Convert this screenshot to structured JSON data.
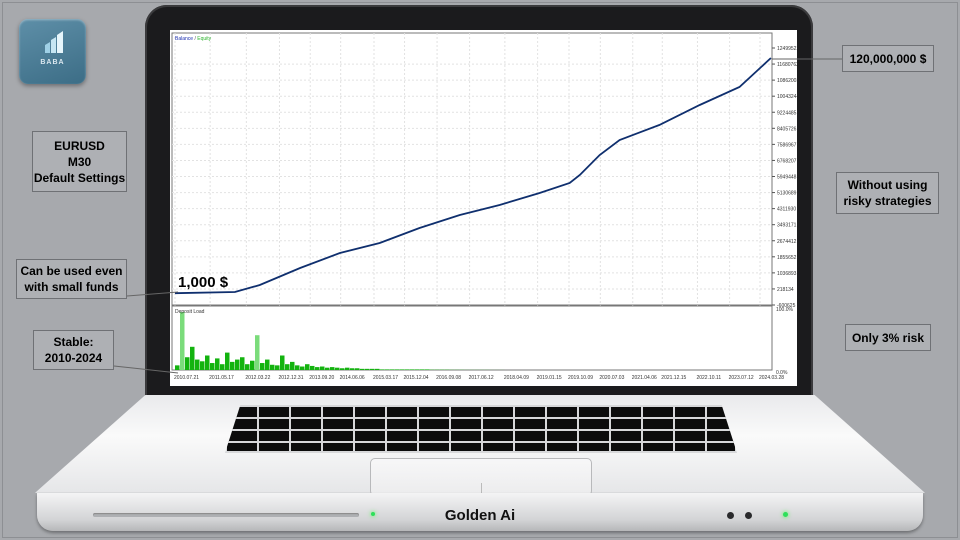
{
  "logo": {
    "text": "BABA"
  },
  "callouts": {
    "pair": [
      "EURUSD",
      "M30",
      "Default Settings"
    ],
    "small_funds": [
      "Can be used even",
      "with small funds"
    ],
    "stable": [
      "Stable:",
      "2010-2024"
    ],
    "final_balance": "120,000,000 $",
    "no_risky": [
      "Without using",
      "risky strategies"
    ],
    "risk": "Only 3% risk"
  },
  "laptop": {
    "brand": "Golden Ai"
  },
  "colors": {
    "balance_line": "#0f2f6e",
    "deposit_load": "#13b30f",
    "deposit_load_light": "#7bdc7b",
    "background": "#a7a9ad"
  },
  "chart_data": [
    {
      "type": "line",
      "legend": {
        "balance": "Balance",
        "sep": " / ",
        "equity": "Equity"
      },
      "legend_placement": "top-left",
      "annotation": "1,000 $",
      "grid": true,
      "ylim": [
        -600625,
        12499522
      ],
      "y_ticks": [
        "12499522",
        "11680762",
        "10862003",
        "10043244",
        "9224485",
        "8405726",
        "7586967",
        "6768207",
        "5949448",
        "5130689",
        "4311930",
        "3493171",
        "2674412",
        "1855652",
        "1036893",
        "218134",
        "-600625"
      ],
      "x_ticks": [
        "2010.07.21",
        "2011.05.17",
        "2012.03.22",
        "2012.12.31",
        "2013.09.20",
        "2014.06.06",
        "2015.03.17",
        "2015.12.04",
        "2016.09.08",
        "2017.06.12",
        "2018.04.09",
        "2019.01.15",
        "2019.10.09",
        "2020.07.03",
        "2021.04.06",
        "2021.12.15",
        "2022.10.11",
        "2023.07.12",
        "2024.03.28"
      ],
      "series": [
        {
          "name": "Balance",
          "points": [
            [
              "2010.07.21",
              1000
            ],
            [
              "2011.12.15",
              62000
            ],
            [
              "2012.07.15",
              419000
            ],
            [
              "2013.06.25",
              1285000
            ],
            [
              "2014.05.30",
              2050000
            ],
            [
              "2015.05.05",
              2560000
            ],
            [
              "2016.04.10",
              3324000
            ],
            [
              "2017.03.20",
              3987000
            ],
            [
              "2018.02.25",
              4497000
            ],
            [
              "2019.02.01",
              5108000
            ],
            [
              "2019.10.15",
              5618000
            ],
            [
              "2020.01.10",
              6026000
            ],
            [
              "2020.06.28",
              7045000
            ],
            [
              "2020.12.15",
              7810000
            ],
            [
              "2021.11.20",
              8575000
            ],
            [
              "2022.10.30",
              9594000
            ],
            [
              "2023.10.05",
              10512000
            ],
            [
              "2024.06.30",
              11990000
            ]
          ]
        }
      ]
    },
    {
      "type": "bar",
      "title": "Deposit Load",
      "ylim": [
        0,
        100
      ],
      "y_ticks": [
        "100.0%",
        "0.0%"
      ],
      "values": [
        8,
        100,
        22,
        40,
        18,
        15,
        25,
        12,
        20,
        10,
        30,
        14,
        18,
        22,
        10,
        16,
        60,
        12,
        18,
        9,
        8,
        25,
        10,
        14,
        8,
        6,
        10,
        7,
        5,
        6,
        4,
        5,
        4,
        3,
        4,
        3,
        3,
        2,
        2,
        2,
        2,
        1,
        1,
        1,
        1,
        1,
        1,
        1,
        1,
        1,
        1,
        0.5,
        0.5,
        0.5,
        0.5,
        0.3,
        0.3,
        0.3,
        0.2,
        0.2,
        0.2,
        0.2,
        0.2,
        0.1,
        0.1,
        0.1
      ]
    }
  ]
}
